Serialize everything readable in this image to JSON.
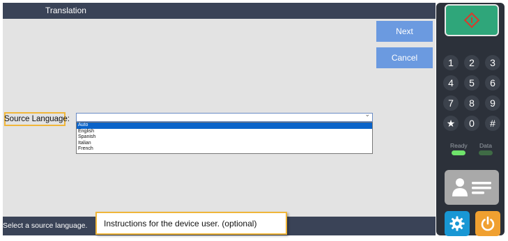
{
  "window": {
    "title": "Translation"
  },
  "buttons": {
    "next_label": "Next",
    "cancel_label": "Cancel"
  },
  "form": {
    "source_language_label": "Source Language:",
    "selected_value": "",
    "options": [
      "Auto",
      "English",
      "Spanish",
      "Italian",
      "French"
    ],
    "highlighted_option": "Auto"
  },
  "status": {
    "text": "Select a source language."
  },
  "callout": {
    "text": "Instructions for the device user. (optional)"
  },
  "keypad": {
    "keys": [
      "1",
      "2",
      "3",
      "4",
      "5",
      "6",
      "7",
      "8",
      "9",
      "★",
      "0",
      "#"
    ]
  },
  "indicators": {
    "ready_label": "Ready",
    "data_label": "Data",
    "ready_color": "#6fe36b",
    "data_color": "#3f6b45"
  },
  "icons": {
    "start": "start-diamond-icon",
    "card": "id-card-icon",
    "settings": "gear-icon",
    "power": "power-icon"
  },
  "colors": {
    "titlebar": "#3a4357",
    "button": "#6b9ae0",
    "highlight_border": "#f0b63a",
    "selected_option": "#0a63c9",
    "start_button": "#2fa67a",
    "settings_button": "#1897d4",
    "power_button": "#f0a030"
  }
}
